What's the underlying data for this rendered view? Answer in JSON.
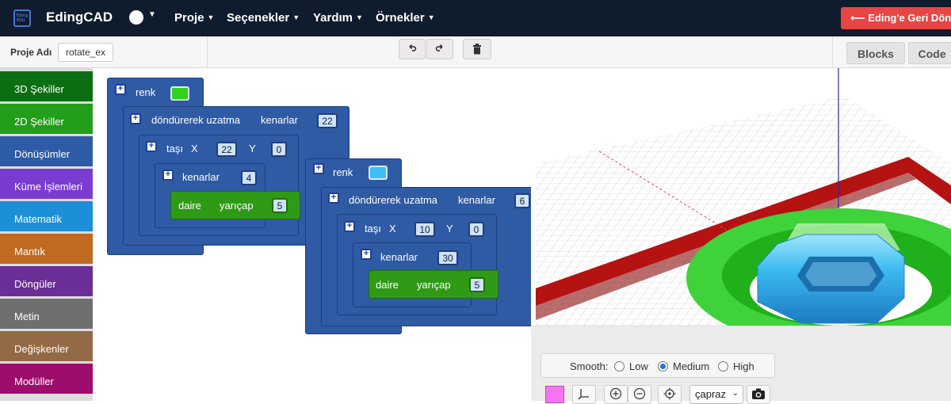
{
  "app": {
    "logo_text": "Eding EDU",
    "brand": "EdingCAD"
  },
  "nav": {
    "menus": [
      {
        "label": "Proje"
      },
      {
        "label": "Seçenekler"
      },
      {
        "label": "Yardım"
      },
      {
        "label": "Örnekler"
      }
    ],
    "back_button": "⟵ Eding'e Geri Dön"
  },
  "toolbar": {
    "project_label": "Proje Adı",
    "project_name": "rotate_ex",
    "undo_icon": "undo-icon",
    "redo_icon": "redo-icon",
    "trash_icon": "trash-icon",
    "tabs": [
      "Blocks",
      "Code"
    ]
  },
  "categories": [
    {
      "label": "3D Şekiller",
      "color": "#0b6e12"
    },
    {
      "label": "2D Şekiller",
      "color": "#239e1a"
    },
    {
      "label": "Dönüşümler",
      "color": "#2d5ba6"
    },
    {
      "label": "Küme İşlemleri",
      "color": "#7a3bd1"
    },
    {
      "label": "Matematik",
      "color": "#1c8fd8"
    },
    {
      "label": "Mantık",
      "color": "#c06a22"
    },
    {
      "label": "Döngüler",
      "color": "#6b2e96"
    },
    {
      "label": "Metin",
      "color": "#6f6f6f"
    },
    {
      "label": "Değişkenler",
      "color": "#936a45"
    },
    {
      "label": "Modüller",
      "color": "#9c0d6c"
    }
  ],
  "workspace": {
    "stack1": {
      "color_label": "renk",
      "color_value": "#32d11c",
      "extrude_label": "döndürerek uzatma",
      "sides_label": "kenarlar",
      "extrude_sides": "22",
      "move_label": "taşı",
      "x_label": "X",
      "x_value": "22",
      "y_label": "Y",
      "y_value": "0",
      "inner_sides_label": "kenarlar",
      "inner_sides": "4",
      "circle_label": "daire",
      "radius_label": "yarıçap",
      "radius": "5"
    },
    "stack2": {
      "color_label": "renk",
      "color_value": "#3cc0f5",
      "extrude_label": "döndürerek uzatma",
      "sides_label": "kenarlar",
      "extrude_sides": "6",
      "move_label": "taşı",
      "x_label": "X",
      "x_value": "10",
      "y_label": "Y",
      "y_value": "0",
      "inner_sides_label": "kenarlar",
      "inner_sides": "30",
      "circle_label": "daire",
      "radius_label": "yarıçap",
      "radius": "5"
    }
  },
  "viewer": {
    "smooth_label": "Smooth:",
    "smooth_options": [
      "Low",
      "Medium",
      "High"
    ],
    "smooth_selected": "Medium",
    "swatch_color": "#f575f0",
    "view_select": "çapraz",
    "icons": [
      "axes-icon",
      "zoom-in-icon",
      "zoom-out-icon",
      "target-icon",
      "camera-icon"
    ]
  }
}
